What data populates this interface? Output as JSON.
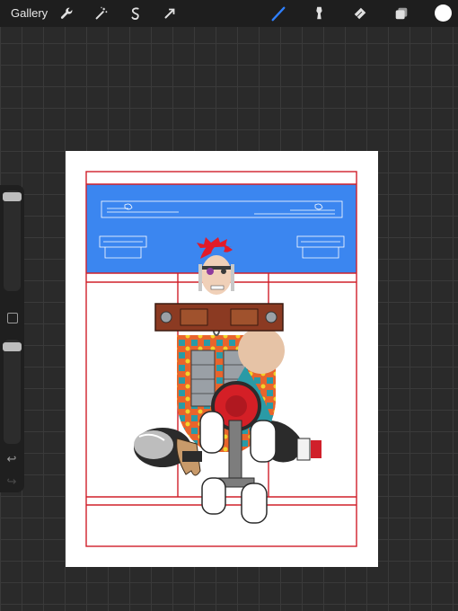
{
  "toolbar": {
    "gallery_label": "Gallery",
    "left_tools": [
      "wrench-icon",
      "magic-wand-icon",
      "selection-icon",
      "transform-arrow-icon"
    ],
    "right_tools": [
      "brush-icon",
      "smudge-icon",
      "eraser-icon",
      "layers-icon"
    ],
    "active_tool": "brush-icon",
    "active_color": "#ffffff",
    "accent": "#2f80ff"
  },
  "sidebar": {
    "items": [
      "brush-size-slider",
      "modify-button",
      "opacity-slider",
      "undo-icon",
      "redo-icon"
    ]
  },
  "canvas": {
    "background": "#ffffff",
    "guide_color": "#d0202a",
    "banner_color": "#3b86f0"
  }
}
